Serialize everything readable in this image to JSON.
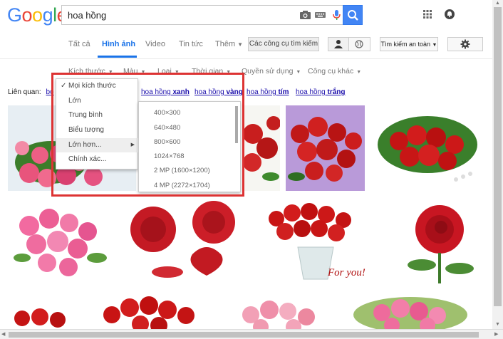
{
  "search": {
    "query": "hoa hồng"
  },
  "tabs": [
    "Tất cả",
    "Hình ảnh",
    "Video",
    "Tin tức",
    "Thêm"
  ],
  "tools_button": "Các công cụ tìm kiếm",
  "safe_search_button": "Tìm kiếm an toàn",
  "filters": [
    "Kích thước",
    "Màu",
    "Loại",
    "Thời gian",
    "Quyền sử dụng",
    "Công cụ khác"
  ],
  "related": {
    "label": "Liên quan:",
    "links": [
      {
        "prefix": "bó",
        "bold": ""
      },
      {
        "prefix": "hoa hồng ",
        "bold": "xanh"
      },
      {
        "prefix": "hoa hồng ",
        "bold": "vàng"
      },
      {
        "prefix": "hoa hồng ",
        "bold": "tím"
      },
      {
        "prefix": "hoa hồng ",
        "bold": "trắng"
      }
    ]
  },
  "size_menu": [
    "Mọi kích thước",
    "Lớn",
    "Trung bình",
    "Biểu tượng",
    "Lớn hơn...",
    "Chính xác..."
  ],
  "larger_menu": [
    "400×300",
    "640×480",
    "800×600",
    "1024×768",
    "2 MP (1600×1200)",
    "4 MP (2272×1704)"
  ],
  "image_caption": "For you!",
  "colors": {
    "accent": "#1a73e8",
    "search_button": "#4285f4",
    "highlight": "#dd3333",
    "link": "#1a0dab"
  }
}
